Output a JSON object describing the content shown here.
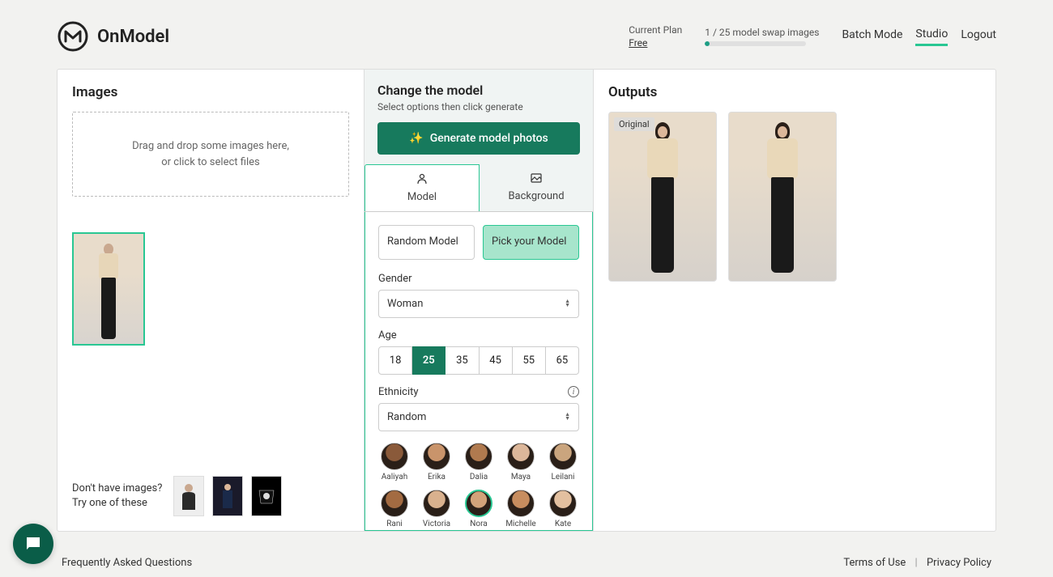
{
  "header": {
    "brand": "OnModel",
    "plan_label": "Current Plan",
    "plan_value": "Free",
    "usage_text": "1 / 25 model swap images",
    "nav": {
      "batch": "Batch Mode",
      "studio": "Studio",
      "logout": "Logout"
    }
  },
  "left": {
    "title": "Images",
    "dropzone_line1": "Drag and drop some images here,",
    "dropzone_line2": "or click to select files",
    "hint_line1": "Don't have images?",
    "hint_line2": "Try one of these"
  },
  "mid": {
    "title": "Change the model",
    "subtitle": "Select options then click generate",
    "generate": "Generate model photos",
    "tabs": {
      "model": "Model",
      "background": "Background"
    },
    "mode": {
      "random": "Random Model",
      "pick": "Pick your Model"
    },
    "gender_label": "Gender",
    "gender_value": "Woman",
    "age_label": "Age",
    "ages": [
      "18",
      "25",
      "35",
      "45",
      "55",
      "65"
    ],
    "age_selected": "25",
    "ethnicity_label": "Ethnicity",
    "ethnicity_value": "Random",
    "models_row1": [
      "Aaliyah",
      "Erika",
      "Dalia",
      "Maya",
      "Leilani"
    ],
    "models_row2": [
      "Rani",
      "Victoria",
      "Nora",
      "Michelle",
      "Kate"
    ]
  },
  "right": {
    "title": "Outputs",
    "original_badge": "Original"
  },
  "footer": {
    "faq": "Frequently Asked Questions",
    "terms": "Terms of Use",
    "privacy": "Privacy Policy"
  }
}
